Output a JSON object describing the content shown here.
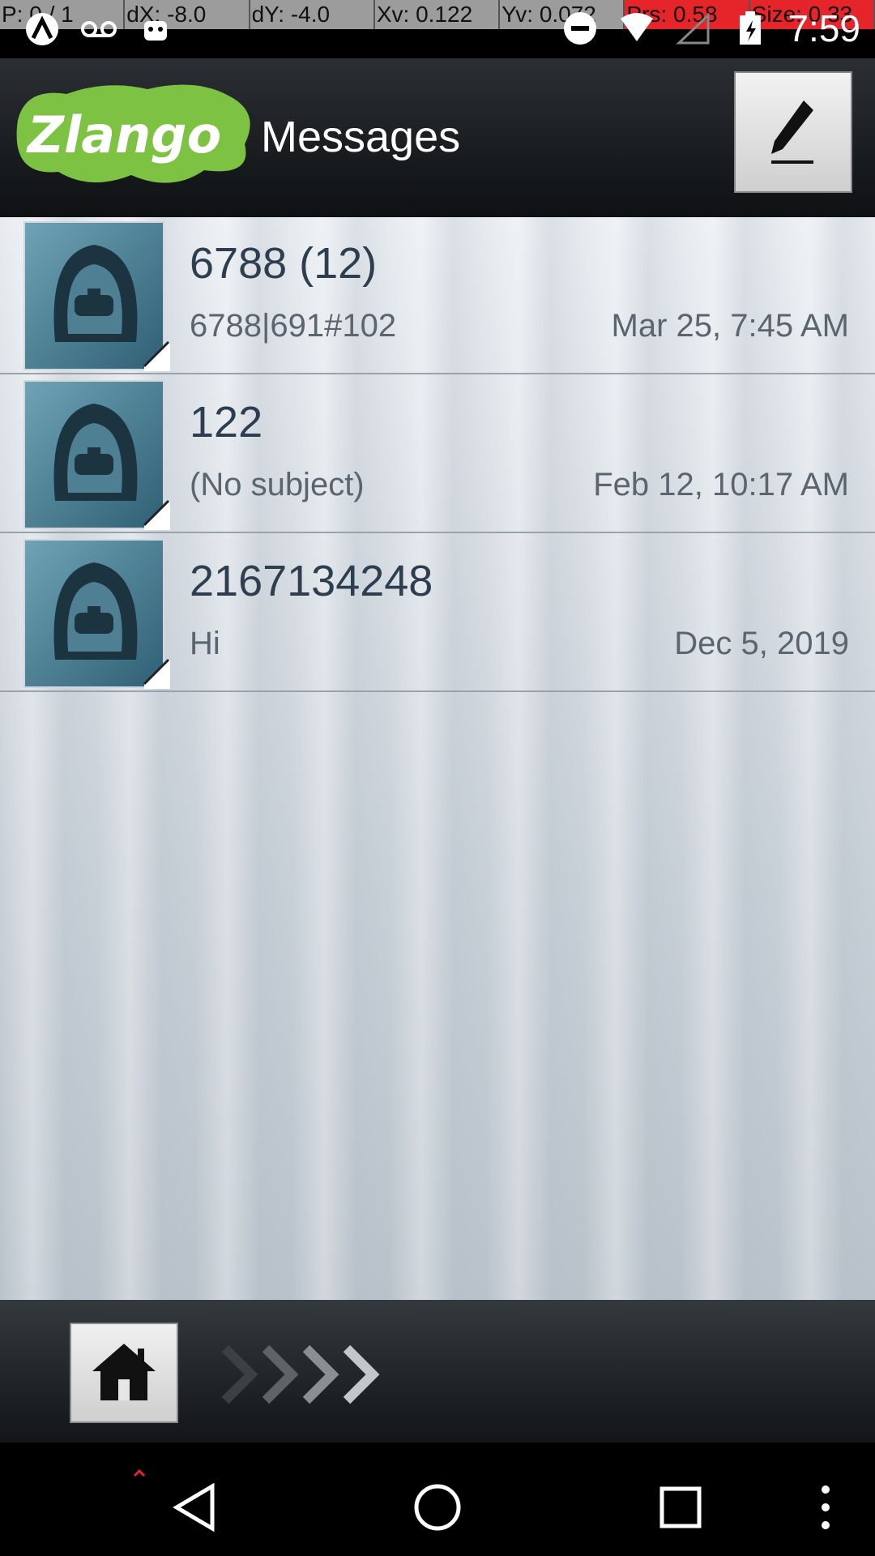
{
  "debug": {
    "p": "P: 0 / 1",
    "dx": "dX: -8.0",
    "dy": "dY: -4.0",
    "xv": "Xv: 0.122",
    "yv": "Yv: 0.072",
    "prs": "Prs: 0.58",
    "size": "Size: 0.33"
  },
  "status": {
    "time": "7:59",
    "icons_left": [
      "app-icon",
      "voicemail-icon",
      "android-icon"
    ],
    "icons_right": [
      "do-not-disturb-icon",
      "wifi-icon",
      "signal-icon",
      "battery-icon"
    ]
  },
  "header": {
    "logo_text": "Zlango",
    "title": "Messages",
    "compose_icon": "pencil-icon"
  },
  "messages": [
    {
      "sender": "6788 (12)",
      "preview": "6788|691#102",
      "date": "Mar 25, 7:45 AM"
    },
    {
      "sender": "122",
      "preview": "(No subject)",
      "date": "Feb 12, 10:17 AM"
    },
    {
      "sender": "2167134248",
      "preview": "Hi",
      "date": "Dec 5, 2019"
    }
  ],
  "toolbar": {
    "home_icon": "home-icon",
    "chevrons_icon": "chevrons-right-icon"
  },
  "navbar": {
    "icons": [
      "back-icon",
      "home-circle-icon",
      "recents-icon",
      "menu-icon"
    ]
  },
  "colors": {
    "logo_green": "#7dc242",
    "accent_red": "#e5252a"
  }
}
